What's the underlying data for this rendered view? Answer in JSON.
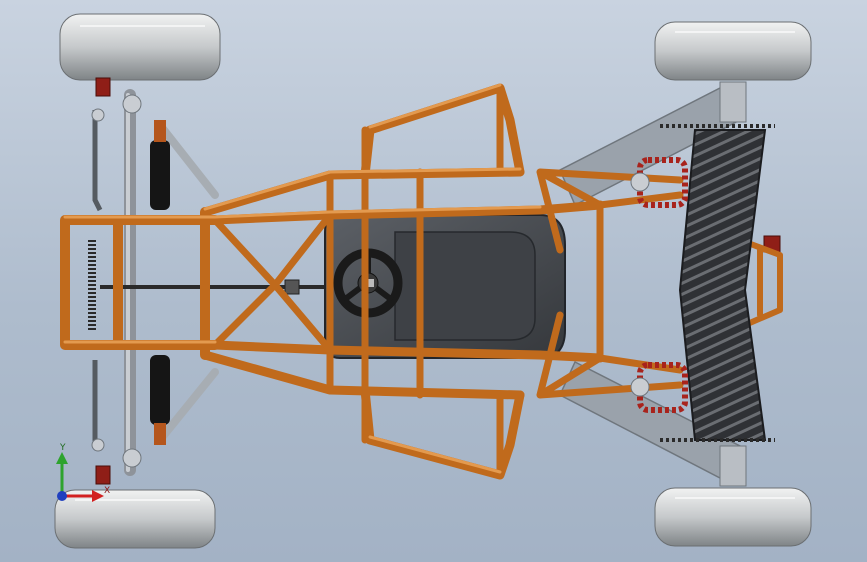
{
  "viewport": {
    "view": "top-view",
    "background_top": "#c9d3e0",
    "background_bottom": "#a3b2c5"
  },
  "colors": {
    "frame_tube": "#c06a1c",
    "frame_highlight": "#e39a4f",
    "steel": "#8e939a",
    "tire": "#d6d8d9",
    "seat": "#4a4d52",
    "cvt_belt": "#3a3c40",
    "spring": "#a8231c",
    "damper": "#151515"
  },
  "triad": {
    "y_axis_label": "Y",
    "x_axis_label": "X",
    "y_color": "#2ea32e",
    "x_color": "#d22020",
    "z_color": "#1f3fbf"
  }
}
